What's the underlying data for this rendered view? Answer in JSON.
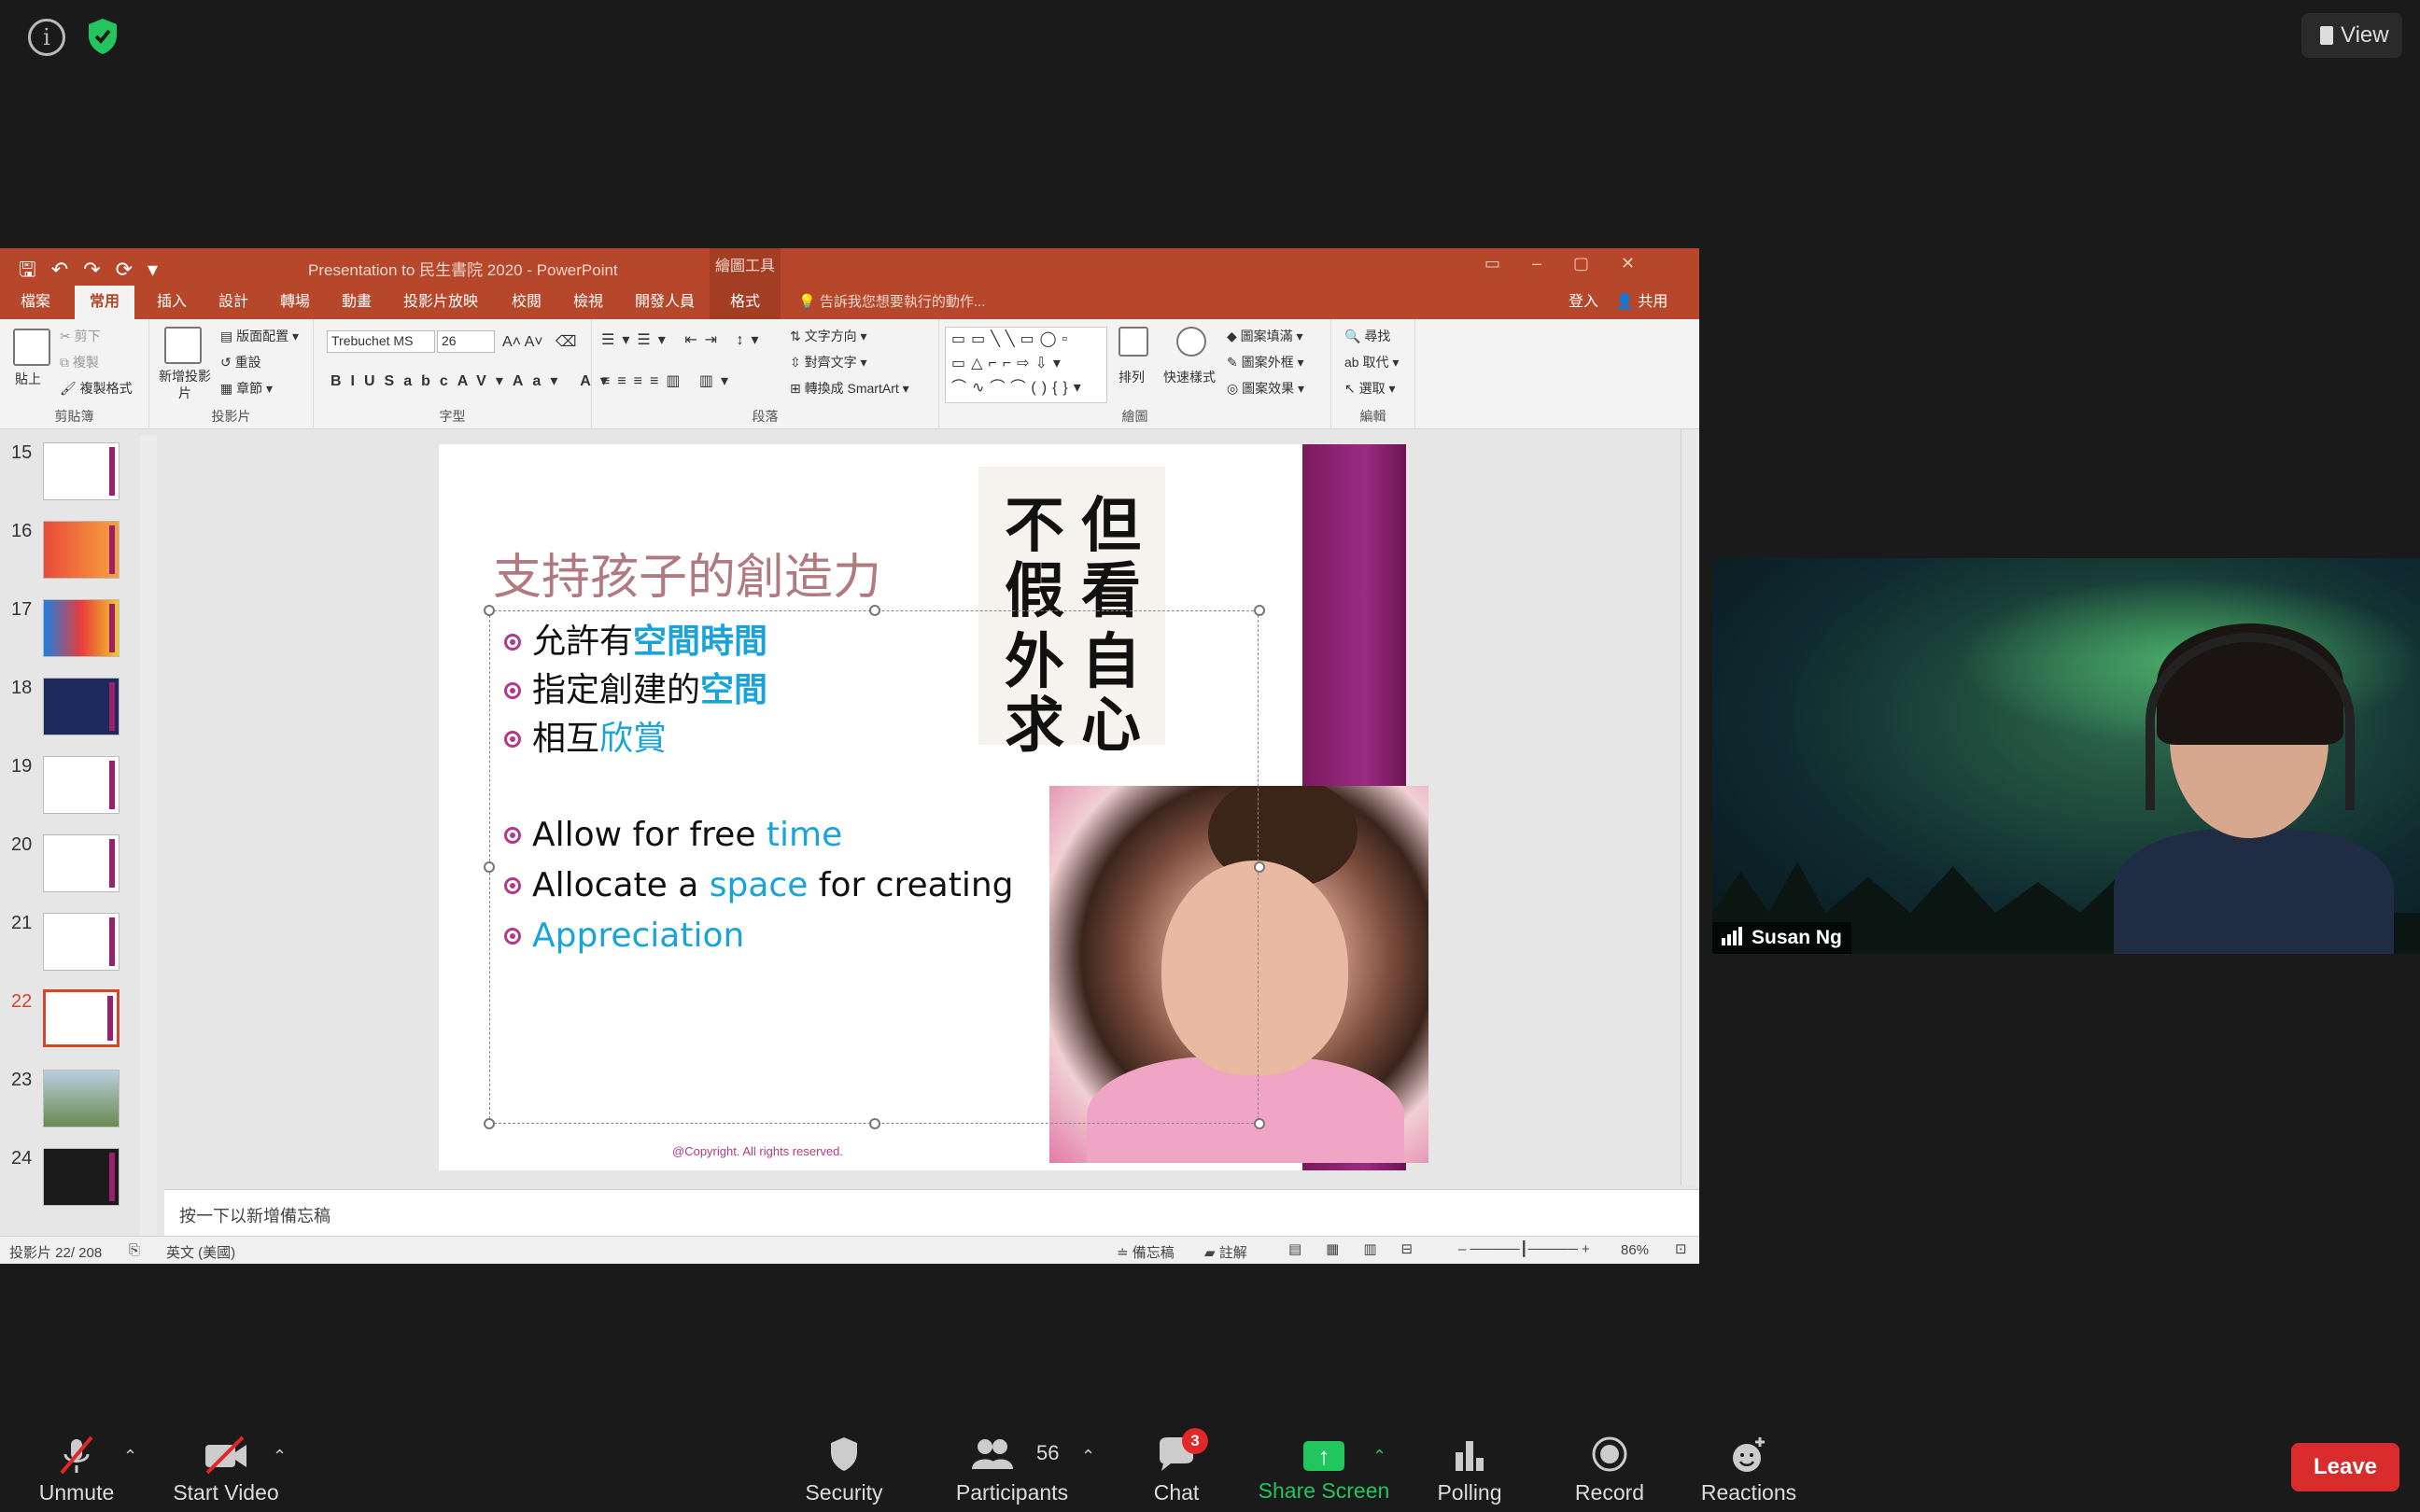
{
  "zoom_top": {
    "view_label": "View"
  },
  "ppt": {
    "title": "Presentation to 民生書院 2020 - PowerPoint",
    "context_tab_title": "繪圖工具",
    "tabs": [
      "檔案",
      "常用",
      "插入",
      "設計",
      "轉場",
      "動畫",
      "投影片放映",
      "校閱",
      "檢視",
      "開發人員",
      "格式"
    ],
    "active_tab": "常用",
    "tell_me": "告訴我您想要執行的動作...",
    "sign_in": "登入",
    "share": "共用",
    "ribbon": {
      "clipboard": {
        "label": "剪貼簿",
        "paste": "貼上",
        "cut": "剪下",
        "copy": "複製",
        "format_painter": "複製格式"
      },
      "slides": {
        "label": "投影片",
        "new_slide": "新增投影片",
        "layout": "版面配置",
        "reset": "重設",
        "section": "章節"
      },
      "font": {
        "label": "字型",
        "font_name": "Trebuchet MS",
        "font_size": "26"
      },
      "paragraph": {
        "label": "段落",
        "text_direction": "文字方向",
        "align_text": "對齊文字",
        "convert_smartart": "轉換成 SmartArt"
      },
      "drawing": {
        "label": "繪圖",
        "arrange": "排列",
        "quick_styles": "快速樣式",
        "shape_fill": "圖案填滿",
        "shape_outline": "圖案外框",
        "shape_effects": "圖案效果"
      },
      "editing": {
        "label": "編輯",
        "find": "尋找",
        "replace": "取代",
        "select": "選取"
      }
    },
    "thumbnails": [
      "15",
      "16",
      "17",
      "18",
      "19",
      "20",
      "21",
      "22",
      "23",
      "24"
    ],
    "active_slide": "22",
    "slide": {
      "title": "支持孩子的創造力",
      "zh_bullets": [
        {
          "pre": "允許有",
          "hl": "空間時間"
        },
        {
          "pre": "指定創建的",
          "hl": "空間"
        },
        {
          "pre": "相互",
          "hl": "欣賞"
        }
      ],
      "en_bullets": [
        {
          "pre": "Allow for free ",
          "hl": "time",
          "post": ""
        },
        {
          "pre": "Allocate a ",
          "hl": "space",
          "post": " for creating"
        },
        {
          "pre": "",
          "hl": "Appreciation",
          "post": ""
        }
      ],
      "calligraphy": [
        "但",
        "看",
        "自",
        "心",
        "不",
        "假",
        "外",
        "求"
      ],
      "copyright": "@Copyright. All rights reserved."
    },
    "notes_placeholder": "按一下以新增備忘稿",
    "status": {
      "slide_count": "投影片 22/ 208",
      "language": "英文 (美國)",
      "notes": "備忘稿",
      "comments": "註解",
      "zoom": "86%"
    }
  },
  "participant": {
    "name": "Susan Ng"
  },
  "toolbar": {
    "unmute": "Unmute",
    "start_video": "Start Video",
    "security": "Security",
    "participants": "Participants",
    "participants_count": "56",
    "chat": "Chat",
    "chat_badge": "3",
    "share_screen": "Share Screen",
    "polling": "Polling",
    "record": "Record",
    "reactions": "Reactions",
    "leave": "Leave"
  }
}
